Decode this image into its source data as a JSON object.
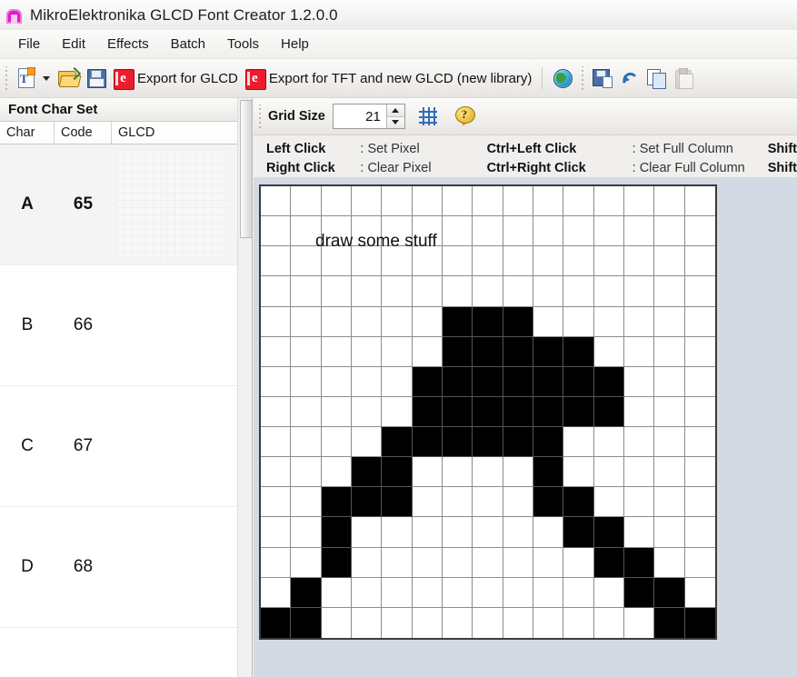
{
  "window": {
    "title": "MikroElektronika GLCD Font Creator 1.2.0.0",
    "icon": "app-icon"
  },
  "menu": {
    "items": [
      {
        "label": "File"
      },
      {
        "label": "Edit"
      },
      {
        "label": "Effects"
      },
      {
        "label": "Batch"
      },
      {
        "label": "Tools"
      },
      {
        "label": "Help"
      }
    ]
  },
  "toolbar": {
    "new_icon": "new-font-icon",
    "new_dropdown_icon": "chevron-down-icon",
    "open_icon": "open-folder-icon",
    "save_icon": "save-floppy-icon",
    "export_glcd_icon": "export-e-icon",
    "export_glcd_label": "Export for GLCD",
    "export_tft_icon": "export-e-icon",
    "export_tft_label": "Export for TFT and new GLCD (new library)",
    "globe_icon": "globe-icon",
    "save_all_icon": "save-as-icon",
    "undo_icon": "undo-arrow-icon",
    "copy_icon": "copy-icon",
    "paste_icon": "paste-icon"
  },
  "left_panel": {
    "header": "Font Char Set",
    "columns": [
      "Char",
      "Code",
      "GLCD"
    ],
    "rows": [
      {
        "char": "A",
        "code": "65",
        "selected": true
      },
      {
        "char": "B",
        "code": "66",
        "selected": false
      },
      {
        "char": "C",
        "code": "67",
        "selected": false
      },
      {
        "char": "D",
        "code": "68",
        "selected": false
      }
    ],
    "scrollbar": "vertical-scrollbar"
  },
  "grid_toolbar": {
    "grid_size_label": "Grid Size",
    "grid_size_value": "21",
    "spin_up_icon": "spinner-up-icon",
    "spin_down_icon": "spinner-down-icon",
    "toggle_grid_icon": "grid-toggle-icon",
    "help_icon": "help-question-icon"
  },
  "legend": {
    "rows": [
      {
        "key1": "Left Click",
        "val1": ": Set Pixel",
        "key2": "Ctrl+Left Click",
        "val2": ": Set Full Column",
        "key3": "Shift"
      },
      {
        "key1": "Right Click",
        "val1": ": Clear Pixel",
        "key2": "Ctrl+Right Click",
        "val2": ": Clear Full Column",
        "key3": "Shift"
      }
    ]
  },
  "canvas": {
    "note": "draw some stuff",
    "cols": 15,
    "rows": 15,
    "on_color": "#000000",
    "off_color": "#ffffff",
    "pixels": [
      [
        0,
        0,
        0,
        0,
        0,
        0,
        0,
        0,
        0,
        0,
        0,
        0,
        0,
        0,
        0
      ],
      [
        0,
        0,
        0,
        0,
        0,
        0,
        0,
        0,
        0,
        0,
        0,
        0,
        0,
        0,
        0
      ],
      [
        0,
        0,
        0,
        0,
        0,
        0,
        0,
        0,
        0,
        0,
        0,
        0,
        0,
        0,
        0
      ],
      [
        0,
        0,
        0,
        0,
        0,
        0,
        0,
        0,
        0,
        0,
        0,
        0,
        0,
        0,
        0
      ],
      [
        0,
        0,
        0,
        0,
        0,
        0,
        0,
        0,
        0,
        0,
        0,
        0,
        0,
        0,
        0
      ],
      [
        0,
        0,
        0,
        0,
        0,
        0,
        1,
        1,
        1,
        0,
        0,
        0,
        0,
        0,
        0
      ],
      [
        0,
        0,
        0,
        0,
        0,
        0,
        1,
        1,
        1,
        1,
        1,
        0,
        0,
        0,
        0
      ],
      [
        0,
        0,
        0,
        0,
        0,
        1,
        1,
        1,
        1,
        1,
        1,
        1,
        0,
        0,
        0
      ],
      [
        0,
        0,
        0,
        0,
        0,
        1,
        1,
        1,
        1,
        1,
        1,
        1,
        0,
        0,
        0
      ],
      [
        0,
        0,
        0,
        0,
        1,
        1,
        1,
        1,
        1,
        1,
        0,
        0,
        0,
        0,
        0
      ],
      [
        0,
        0,
        0,
        1,
        1,
        0,
        0,
        0,
        0,
        1,
        0,
        0,
        0,
        0,
        0
      ],
      [
        0,
        0,
        1,
        1,
        1,
        0,
        0,
        0,
        0,
        1,
        1,
        0,
        0,
        0,
        0
      ],
      [
        0,
        0,
        1,
        0,
        0,
        0,
        0,
        0,
        0,
        0,
        1,
        1,
        0,
        0,
        0
      ],
      [
        0,
        0,
        1,
        0,
        0,
        0,
        0,
        0,
        0,
        0,
        0,
        1,
        1,
        0,
        0
      ],
      [
        0,
        1,
        0,
        0,
        0,
        0,
        0,
        0,
        0,
        0,
        0,
        0,
        1,
        1,
        0
      ],
      [
        1,
        1,
        0,
        0,
        0,
        0,
        0,
        0,
        0,
        0,
        0,
        0,
        0,
        1,
        1
      ]
    ]
  }
}
